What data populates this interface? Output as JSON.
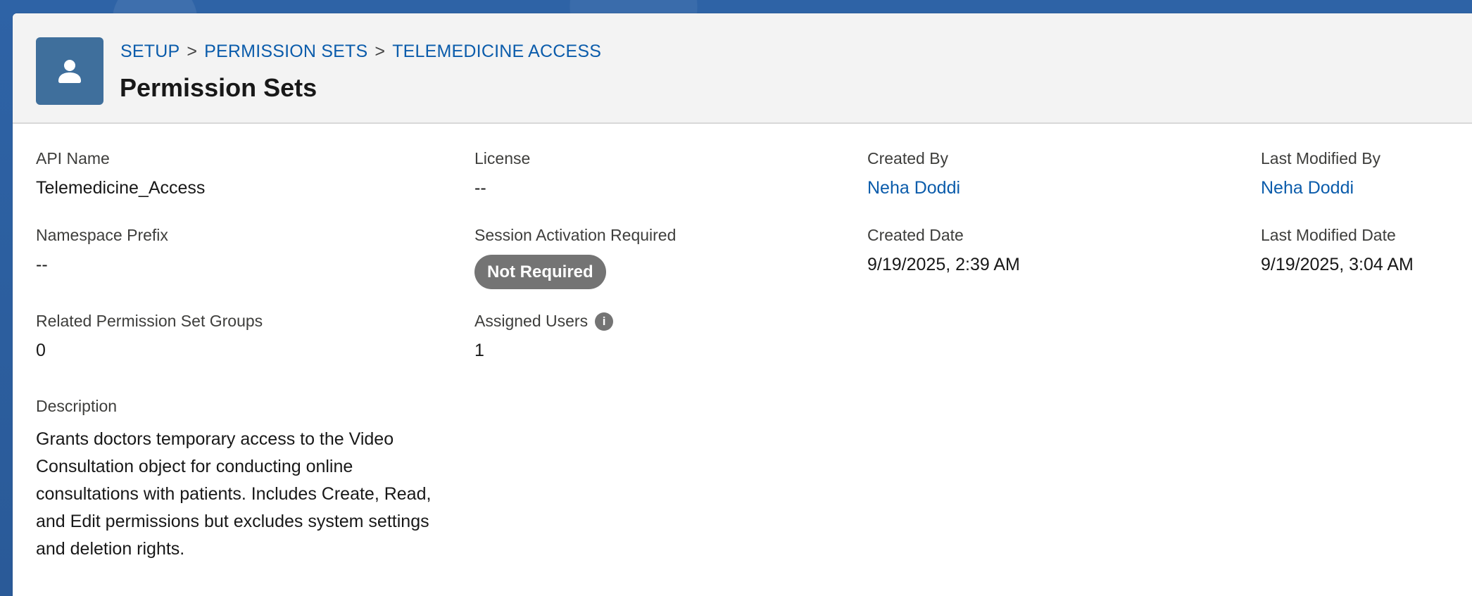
{
  "breadcrumb": {
    "items": [
      "SETUP",
      "PERMISSION SETS",
      "TELEMEDICINE ACCESS"
    ],
    "separator": ">"
  },
  "header": {
    "title": "Permission Sets",
    "icon": "user-icon"
  },
  "fields": {
    "api_name": {
      "label": "API Name",
      "value": "Telemedicine_Access"
    },
    "license": {
      "label": "License",
      "value": "--"
    },
    "created_by": {
      "label": "Created By",
      "value": "Neha Doddi"
    },
    "last_modified_by": {
      "label": "Last Modified By",
      "value": "Neha Doddi"
    },
    "namespace_prefix": {
      "label": "Namespace Prefix",
      "value": "--"
    },
    "session_activation": {
      "label": "Session Activation Required",
      "value": "Not Required"
    },
    "created_date": {
      "label": "Created Date",
      "value": "9/19/2025, 2:39 AM"
    },
    "last_modified_date": {
      "label": "Last Modified Date",
      "value": "9/19/2025, 3:04 AM"
    },
    "related_groups": {
      "label": "Related Permission Set Groups",
      "value": "0"
    },
    "assigned_users": {
      "label": "Assigned Users",
      "value": "1",
      "info_icon": "info-icon"
    },
    "description": {
      "label": "Description",
      "value": "Grants doctors temporary access to the Video Consultation object for conducting online consultations with patients. Includes Create, Read, and Edit permissions but excludes system settings and deletion rights."
    }
  },
  "colors": {
    "link": "#0b5cab",
    "header_icon_bg": "#3f6f9c",
    "badge_bg": "#747474",
    "background": "#2f5fa0"
  }
}
